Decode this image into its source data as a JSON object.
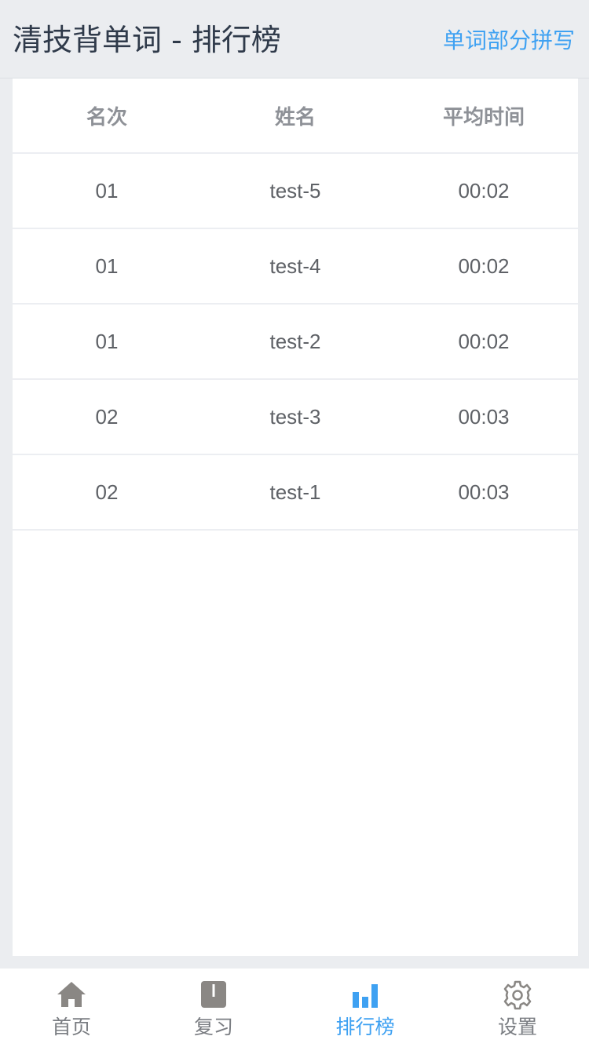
{
  "header": {
    "title": "清技背单词 - 排行榜",
    "action_label": "单词部分拼写"
  },
  "table": {
    "columns": [
      "名次",
      "姓名",
      "平均时间"
    ],
    "rows": [
      {
        "rank": "01",
        "name": "test-5",
        "time": "00:02"
      },
      {
        "rank": "01",
        "name": "test-4",
        "time": "00:02"
      },
      {
        "rank": "01",
        "name": "test-2",
        "time": "00:02"
      },
      {
        "rank": "02",
        "name": "test-3",
        "time": "00:03"
      },
      {
        "rank": "02",
        "name": "test-1",
        "time": "00:03"
      }
    ]
  },
  "tabbar": {
    "tabs": [
      {
        "label": "首页",
        "icon": "home-icon"
      },
      {
        "label": "复习",
        "icon": "book-icon"
      },
      {
        "label": "排行榜",
        "icon": "bar-chart-icon",
        "active": true
      },
      {
        "label": "设置",
        "icon": "gear-icon"
      }
    ]
  },
  "colors": {
    "accent": "#3ea1f2",
    "inactive_icon": "#8a8784",
    "title": "#2f3a4a",
    "background": "#ebedf0"
  }
}
